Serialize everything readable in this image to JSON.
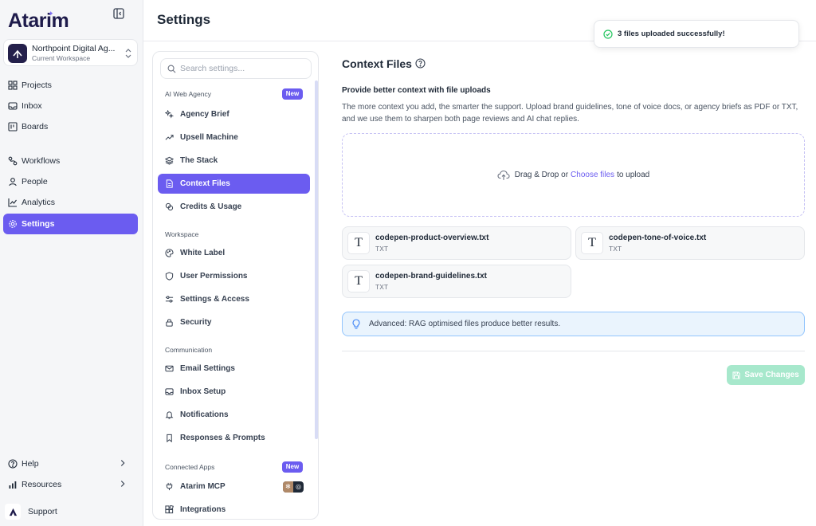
{
  "app": {
    "logo": "Atarim"
  },
  "workspace": {
    "name": "Northpoint Digital Ag...",
    "subtitle": "Current Workspace"
  },
  "nav": {
    "items": [
      {
        "label": "Projects",
        "icon": "grid-icon"
      },
      {
        "label": "Inbox",
        "icon": "inbox-icon"
      },
      {
        "label": "Boards",
        "icon": "board-icon"
      },
      {
        "label": "Workflows",
        "icon": "workflow-icon"
      },
      {
        "label": "People",
        "icon": "person-icon"
      },
      {
        "label": "Analytics",
        "icon": "chart-line-icon"
      },
      {
        "label": "Settings",
        "icon": "gear-icon",
        "active": true
      }
    ],
    "bottom": [
      {
        "label": "Help",
        "icon": "help-circle-icon"
      },
      {
        "label": "Resources",
        "icon": "bar-chart-icon"
      }
    ],
    "support": "Support"
  },
  "header": {
    "title": "Settings"
  },
  "settings_menu": {
    "search_placeholder": "Search settings...",
    "sections": [
      {
        "label": "AI Web Agency",
        "badge": "New",
        "items": [
          "Agency Brief",
          "Upsell Machine",
          "The Stack",
          "Context Files",
          "Credits & Usage"
        ]
      },
      {
        "label": "Workspace",
        "items": [
          "White Label",
          "User Permissions",
          "Settings & Access",
          "Security"
        ]
      },
      {
        "label": "Communication",
        "items": [
          "Email Settings",
          "Inbox Setup",
          "Notifications",
          "Responses & Prompts"
        ]
      },
      {
        "label": "Connected Apps",
        "badge": "New",
        "items": [
          "Atarim MCP",
          "Integrations"
        ]
      }
    ],
    "active": "Context Files"
  },
  "content": {
    "title": "Context Files",
    "subhead": "Provide better context with file uploads",
    "description": "The more context you add, the smarter the support. Upload brand guidelines, tone of voice docs, or agency briefs as PDF or TXT, and we use them to sharpen both page reviews and AI chat replies.",
    "dropzone": {
      "prefix": "Drag & Drop or",
      "link": "Choose files",
      "suffix": "to upload"
    },
    "files": [
      {
        "name": "codepen-product-overview.txt",
        "type": "TXT",
        "icon_letter": "T"
      },
      {
        "name": "codepen-tone-of-voice.txt",
        "type": "TXT",
        "icon_letter": "T"
      },
      {
        "name": "codepen-brand-guidelines.txt",
        "type": "TXT",
        "icon_letter": "T"
      }
    ],
    "info": "Advanced: RAG optimised files produce better results.",
    "save_label": "Save Changes"
  },
  "toast": {
    "message": "3 files uploaded successfully!"
  },
  "colors": {
    "accent": "#6b5cf0",
    "save_disabled": "#a7e8cc",
    "info_border": "#93c5fd",
    "success": "#22c55e"
  }
}
